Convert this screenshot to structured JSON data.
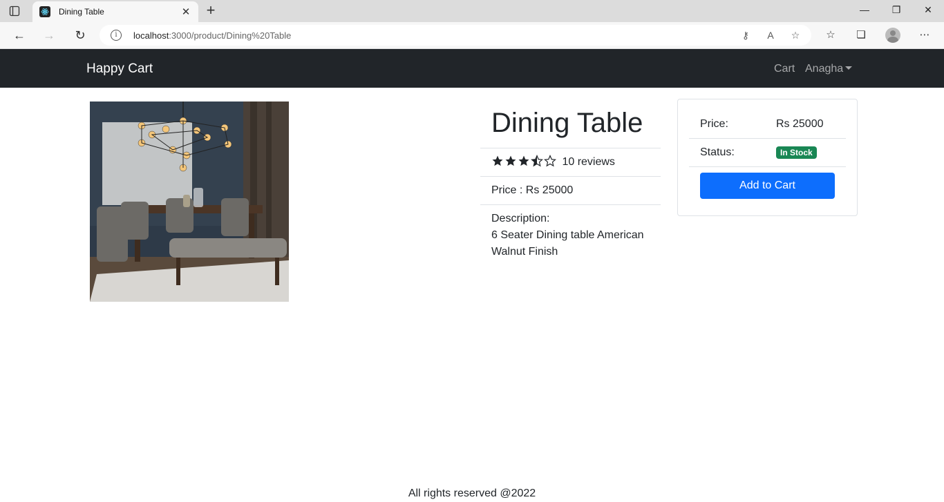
{
  "browser": {
    "tab_title": "Dining Table",
    "url_host": "localhost",
    "url_path": ":3000/product/Dining%20Table"
  },
  "navbar": {
    "brand": "Happy Cart",
    "cart_label": "Cart",
    "user_label": "Anagha"
  },
  "product": {
    "name": "Dining Table",
    "rating": 3.5,
    "reviews_text": "10 reviews",
    "price_text": "Price : Rs 25000",
    "description_label": "Description:",
    "description": "6 Seater Dining table American Walnut Finish"
  },
  "summary": {
    "price_label": "Price:",
    "price_value": "Rs 25000",
    "status_label": "Status:",
    "status_value": "In Stock",
    "add_to_cart": "Add to Cart"
  },
  "footer": {
    "text": "All rights reserved @2022"
  },
  "colors": {
    "navbar_bg": "#212529",
    "button_primary": "#0d6efd",
    "badge_success": "#198754"
  }
}
